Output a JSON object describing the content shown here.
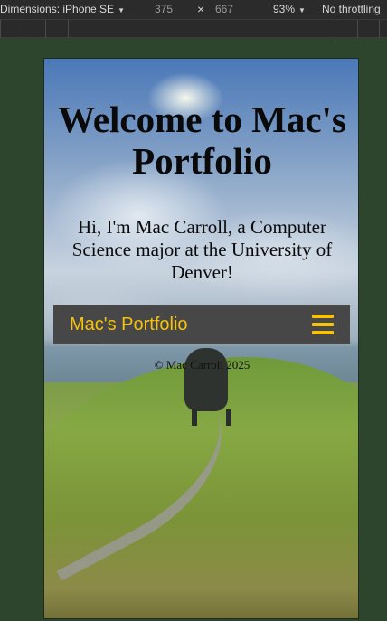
{
  "devtools": {
    "device_label": "Dimensions: iPhone SE",
    "width": "375",
    "times": "×",
    "height": "667",
    "zoom": "93%",
    "throttling": "No throttling"
  },
  "page": {
    "title": "Welcome to Mac's Portfolio",
    "intro": "Hi, I'm Mac Carroll, a Computer Science major at the University of Denver!",
    "nav": {
      "brand": "Mac's Portfolio",
      "menu_icon": "hamburger-menu-icon",
      "accent_color": "#f7c20a",
      "background_color": "#474747"
    },
    "footer": "© Mac Carroll 2025"
  }
}
